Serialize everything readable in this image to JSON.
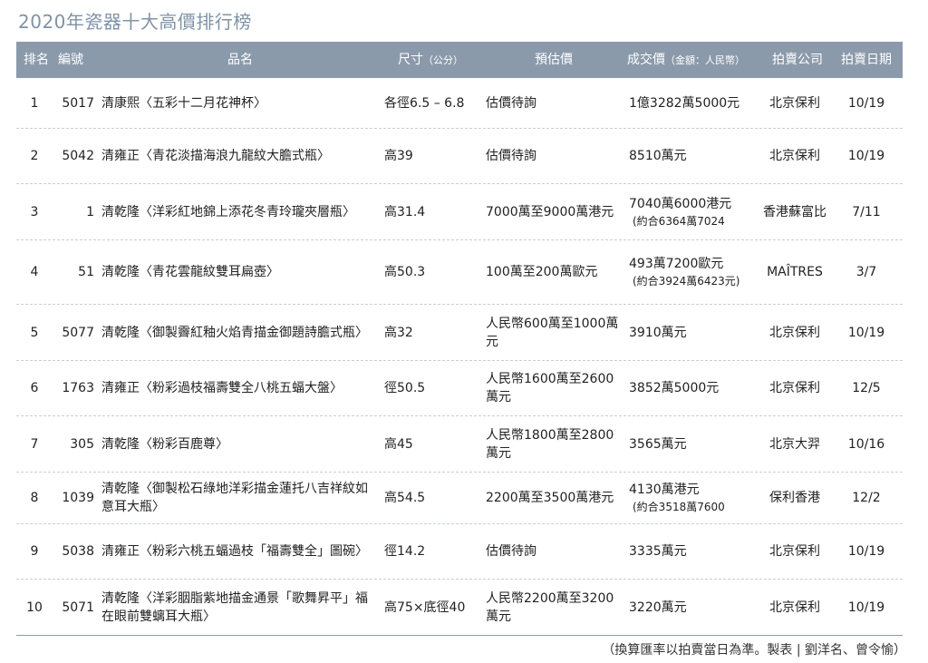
{
  "title": "2020年瓷器十大高價排行榜",
  "headers": {
    "rank": "排名",
    "number": "編號",
    "name": "品名",
    "size": "尺寸",
    "size_unit": "（公分）",
    "estimate": "預估價",
    "price": "成交價",
    "price_unit": "（金額：人民幣）",
    "company": "拍賣公司",
    "date": "拍賣日期"
  },
  "rows": [
    {
      "rank": "1",
      "number": "5017",
      "name": "清康熙〈五彩十二月花神杯〉",
      "size": "各徑6.5 – 6.8",
      "estimate": "估價待詢",
      "price": "1億3282萬5000元",
      "price_note": "",
      "company": "北京保利",
      "date": "10/19"
    },
    {
      "rank": "2",
      "number": "5042",
      "name": "清雍正〈青花淡描海浪九龍紋大膽式瓶〉",
      "size": "高39",
      "estimate": "估價待詢",
      "price": "8510萬元",
      "price_note": "",
      "company": "北京保利",
      "date": "10/19"
    },
    {
      "rank": "3",
      "number": "1",
      "name": "清乾隆〈洋彩紅地錦上添花冬青玲瓏夾層瓶〉",
      "size": "高31.4",
      "estimate": "7000萬至9000萬港元",
      "price": "7040萬6000港元",
      "price_note": "(約合6364萬7024",
      "company": "香港蘇富比",
      "date": "7/11"
    },
    {
      "rank": "4",
      "number": "51",
      "name": "清乾隆〈青花雲龍紋雙耳扁壺〉",
      "size": "高50.3",
      "estimate": "100萬至200萬歐元",
      "price": "493萬7200歐元",
      "price_note": "(約合3924萬6423元)",
      "company": "MAÎTRES",
      "date": "3/7"
    },
    {
      "rank": "5",
      "number": "5077",
      "name": "清乾隆〈御製霽紅釉火焰青描金御題詩膽式瓶〉",
      "size": "高32",
      "estimate": "人民幣600萬至1000萬元",
      "price": "3910萬元",
      "price_note": "",
      "company": "北京保利",
      "date": "10/19"
    },
    {
      "rank": "6",
      "number": "1763",
      "name": "清雍正〈粉彩過枝福壽雙全八桃五蝠大盤〉",
      "size": "徑50.5",
      "estimate": "人民幣1600萬至2600萬元",
      "price": "3852萬5000元",
      "price_note": "",
      "company": "北京保利",
      "date": "12/5"
    },
    {
      "rank": "7",
      "number": "305",
      "name": "清乾隆〈粉彩百鹿尊〉",
      "size": "高45",
      "estimate": "人民幣1800萬至2800萬元",
      "price": "3565萬元",
      "price_note": "",
      "company": "北京大羿",
      "date": "10/16"
    },
    {
      "rank": "8",
      "number": "1039",
      "name": "清乾隆〈御製松石綠地洋彩描金蓮托八吉祥紋如意耳大瓶〉",
      "size": "高54.5",
      "estimate": "2200萬至3500萬港元",
      "price": "4130萬港元",
      "price_note": "(約合3518萬7600",
      "company": "保利香港",
      "date": "12/2"
    },
    {
      "rank": "9",
      "number": "5038",
      "name": "清雍正〈粉彩六桃五蝠過枝「福壽雙全」圖碗〉",
      "size": "徑14.2",
      "estimate": "估價待詢",
      "price": "3335萬元",
      "price_note": "",
      "company": "北京保利",
      "date": "10/19"
    },
    {
      "rank": "10",
      "number": "5071",
      "name": "清乾隆〈洋彩胭脂紫地描金通景「歌舞昇平」福在眼前雙螭耳大瓶〉",
      "size": "高75×底徑40",
      "estimate": "人民幣2200萬至3200萬元",
      "price": "3220萬元",
      "price_note": "",
      "company": "北京保利",
      "date": "10/19"
    }
  ],
  "footer": "（換算匯率以拍賣當日為準。製表 | 劉洋名、曾令愉）"
}
